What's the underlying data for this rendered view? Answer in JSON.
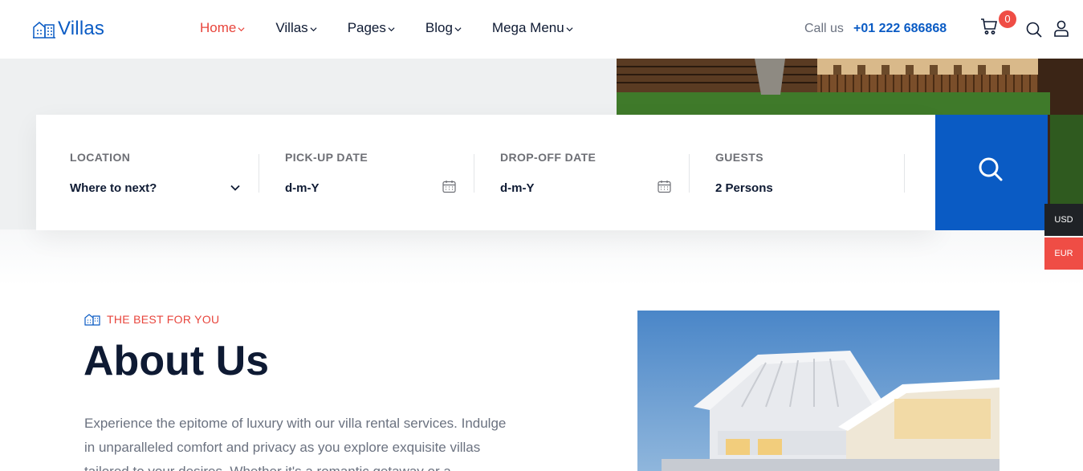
{
  "header": {
    "logo_text": "Villas",
    "nav": [
      {
        "label": "Home",
        "active": true
      },
      {
        "label": "Villas",
        "active": false
      },
      {
        "label": "Pages",
        "active": false
      },
      {
        "label": "Blog",
        "active": false
      },
      {
        "label": "Mega Menu",
        "active": false
      }
    ],
    "call_label": "Call us",
    "phone": "+01 222 686868",
    "cart_count": "0"
  },
  "search": {
    "location": {
      "label": "LOCATION",
      "value": "Where to next?"
    },
    "pickup": {
      "label": "PICK-UP DATE",
      "value": "d-m-Y"
    },
    "dropoff": {
      "label": "DROP-OFF DATE",
      "value": "d-m-Y"
    },
    "guests": {
      "label": "GUESTS",
      "value": "2 Persons"
    }
  },
  "currency": {
    "usd": "USD",
    "eur": "EUR"
  },
  "about": {
    "tag": "THE BEST FOR YOU",
    "title": "About Us",
    "text": "Experience the epitome of luxury with our villa rental services. Indulge in unparalleled comfort and privacy as you explore exquisite villas tailored to your desires. Whether it's a romantic getaway or a"
  },
  "colors": {
    "brand_blue": "#0a5bc4",
    "accent_red": "#e8453c",
    "dark": "#0e1a33"
  },
  "icons": {
    "logo": "building-icon",
    "cart": "cart-icon",
    "search": "search-icon",
    "user": "user-icon",
    "calendar": "calendar-icon",
    "chevron": "chevron-down-icon"
  }
}
